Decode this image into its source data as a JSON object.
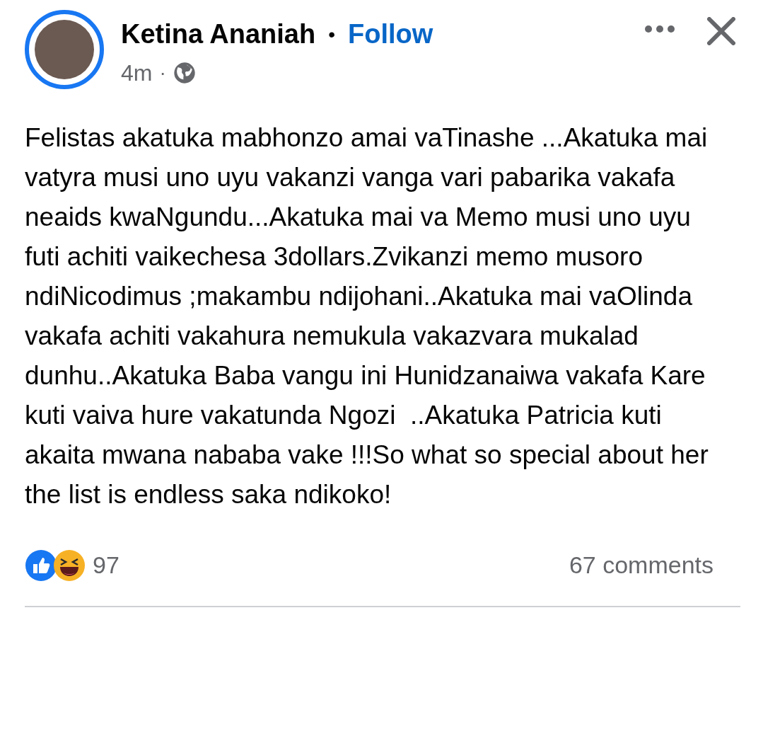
{
  "post": {
    "author": "Ketina Ananiah",
    "separator": "•",
    "follow": "Follow",
    "time": "4m",
    "time_separator": "·",
    "text": "Felistas akatuka mabhonzo amai vaTinashe ...Akatuka mai vatyra musi uno uyu vakanzi vanga vari pabarika vakafa neaids kwaNgundu...Akatuka mai va Memo musi uno uyu futi achiti vaikechesa 3dollars.Zvikanzi memo musoro ndiNicodimus ;makambu ndijohani..Akatuka mai vaOlinda vakafa achiti vakahura nemukula vakazvara mukalad dunhu..Akatuka Baba vangu ini Hunidzanaiwa vakafa Kare kuti vaiva hure vakatunda Ngozi  ..Akatuka Patricia kuti akaita mwana nababa vake !!!So what so special about her the list is endless saka ndikoko!",
    "reactions": {
      "count": "97"
    },
    "comments": "67 comments"
  }
}
